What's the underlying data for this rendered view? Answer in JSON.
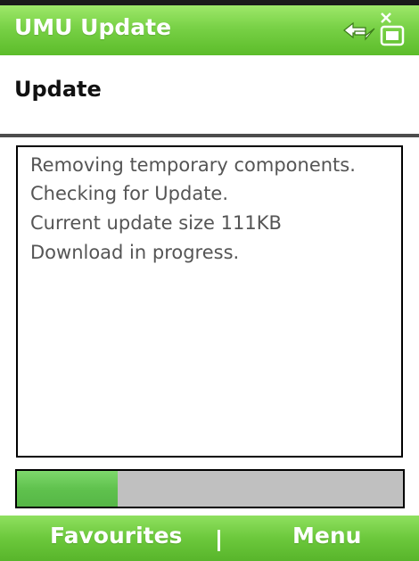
{
  "app": {
    "title": "UMU Update",
    "accent_color": "#6cc83c"
  },
  "status_icons": {
    "connectivity_icon": "sync-arrows-icon",
    "signal_icon": "no-signal-icon"
  },
  "header": {
    "heading": "Update"
  },
  "log": {
    "lines": [
      "Removing temporary components.",
      "Checking for Update.",
      "Current update size 111KB",
      "Download in progress."
    ]
  },
  "progress": {
    "fraction": 0.26
  },
  "softkeys": {
    "left_label": "Favourites",
    "right_label": "Menu"
  }
}
